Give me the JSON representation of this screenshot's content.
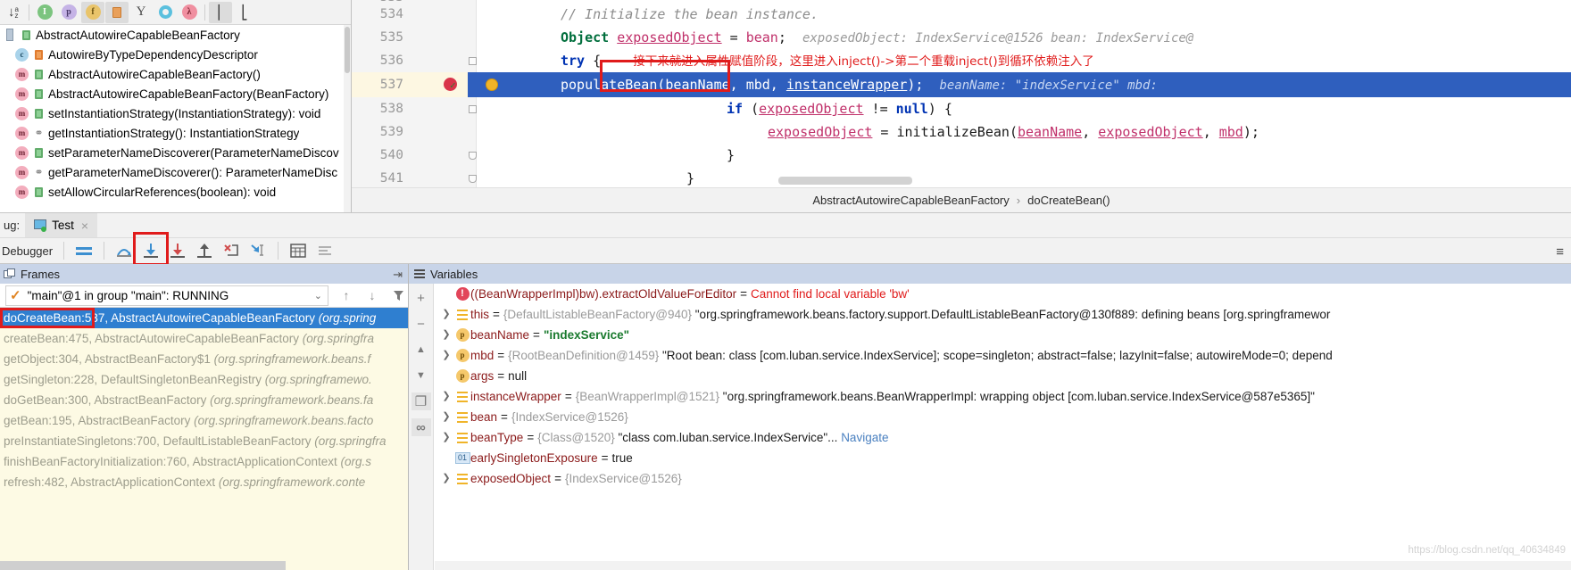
{
  "structure": {
    "toolbar_buttons": [
      {
        "name": "sort-alphabetically-icon",
        "glyph": "↓",
        "sub": "az",
        "selected": false
      },
      {
        "name": "show-inherited-icon",
        "glyph": "I",
        "color": "#7cc47f",
        "selected": false
      },
      {
        "name": "show-properties-icon",
        "glyph": "p",
        "color": "#c5b3e6",
        "selected": false
      },
      {
        "name": "show-fields-icon",
        "glyph": "f",
        "color": "#e9c46a",
        "selected": true
      },
      {
        "name": "show-non-public-icon",
        "glyph": "■",
        "color": "#e9a05a",
        "selected": true
      },
      {
        "name": "show-anonymous-classes-icon",
        "glyph": "Y",
        "color": "#5a5a5a",
        "selected": false
      },
      {
        "name": "show-lambdas-icon",
        "glyph": "○",
        "color": "#5bc0de",
        "selected": false
      },
      {
        "name": "show-lambda-bodies-icon",
        "glyph": "λ",
        "color": "#f08fa0",
        "selected": false
      },
      {
        "name": "expand-all-icon",
        "glyph": "⤒",
        "selected": true
      },
      {
        "name": "collapse-all-icon",
        "glyph": "⤓",
        "selected": false
      }
    ],
    "items": [
      {
        "kind": "class",
        "vis": "lock-green",
        "label": "AbstractAutowireCapableBeanFactory",
        "indent": 0
      },
      {
        "kind": "inner",
        "vis": "lock-orange",
        "label": "AutowireByTypeDependencyDescriptor",
        "indent": 1
      },
      {
        "kind": "method",
        "vis": "lock-green",
        "label": "AbstractAutowireCapableBeanFactory()",
        "indent": 1
      },
      {
        "kind": "method",
        "vis": "lock-green",
        "label": "AbstractAutowireCapableBeanFactory(BeanFactory)",
        "indent": 1
      },
      {
        "kind": "method",
        "vis": "lock-green",
        "label": "setInstantiationStrategy(InstantiationStrategy): void",
        "indent": 1
      },
      {
        "kind": "method",
        "vis": "key",
        "label": "getInstantiationStrategy(): InstantiationStrategy",
        "indent": 1
      },
      {
        "kind": "method",
        "vis": "lock-green",
        "label": "setParameterNameDiscoverer(ParameterNameDiscov",
        "indent": 1
      },
      {
        "kind": "method",
        "vis": "key",
        "label": "getParameterNameDiscoverer(): ParameterNameDisc",
        "indent": 1
      },
      {
        "kind": "method",
        "vis": "lock-green",
        "label": "setAllowCircularReferences(boolean): void",
        "indent": 1
      }
    ]
  },
  "editor": {
    "lines": [
      {
        "num": "533",
        "partial": true
      },
      {
        "num": "534"
      },
      {
        "num": "535"
      },
      {
        "num": "536"
      },
      {
        "num": "537",
        "current": true
      },
      {
        "num": "538"
      },
      {
        "num": "539"
      },
      {
        "num": "540"
      },
      {
        "num": "541"
      }
    ],
    "code": {
      "comment_534": "// Initialize the bean instance.",
      "l535_type": "Object",
      "l535_var": "exposedObject",
      "l535_eq": " = ",
      "l535_val": "bean",
      "l535_semi": ";",
      "l535_hint": "exposedObject:  IndexService@1526   bean:  IndexService@",
      "l536_try": "try",
      "l536_brace": " {",
      "l536_note": "接下来就进入属性赋值阶段，这里进入inject()->第二个重载inject()到循环依赖注入了",
      "l537_call": "populateBean",
      "l537_args": "(beanName, mbd, ",
      "l537_arg3": "instanceWrapper",
      "l537_tail": ");",
      "l537_hint": "beanName:  \"indexService\"   mbd:",
      "l538_if": "if",
      "l538_open": " (",
      "l538_var": "exposedObject",
      "l538_op": " != ",
      "l538_null": "null",
      "l538_close": ") {",
      "l539_var": "exposedObject",
      "l539_eq": " = ",
      "l539_call": "initializeBean",
      "l539_open": "(",
      "l539_a1": "beanName",
      "l539_c1": ", ",
      "l539_a2": "exposedObject",
      "l539_c2": ", ",
      "l539_a3": "mbd",
      "l539_close": ");",
      "l540_brace": "}",
      "l541_brace": "}"
    },
    "breadcrumb": {
      "class": "AbstractAutowireCapableBeanFactory",
      "separator": "›",
      "method": "doCreateBean()"
    }
  },
  "debug_window": {
    "label": "ug:",
    "tab_title": "Test",
    "tab_close": "×",
    "toolbar_title": "Debugger",
    "toolbar_buttons": [
      {
        "name": "show-execution-point-button",
        "glyph": "☰"
      },
      {
        "name": "step-over-button",
        "glyph": "⤴"
      },
      {
        "name": "step-into-button",
        "glyph": "↓",
        "highlighted": true
      },
      {
        "name": "force-step-into-button",
        "glyph": "↓"
      },
      {
        "name": "step-out-button",
        "glyph": "↑"
      },
      {
        "name": "drop-frame-button",
        "glyph": "✗"
      },
      {
        "name": "run-to-cursor-button",
        "glyph": "↘"
      },
      {
        "name": "evaluate-expression-button",
        "glyph": "▦"
      },
      {
        "name": "settings-button",
        "glyph": "≣"
      }
    ],
    "menu_glyph": "≡"
  },
  "frames": {
    "header": "Frames",
    "pin_glyph": "⇥",
    "thread": "\"main\"@1 in group \"main\": RUNNING",
    "chevron": "⌄",
    "nav_up": "↑",
    "nav_down": "↓",
    "filter": "ᐳ",
    "items": [
      {
        "method": "doCreateBean:537",
        "cls": ", AbstractAutowireCapableBeanFactory ",
        "pkg": "(org.spring",
        "active": true
      },
      {
        "method": "createBean:475",
        "cls": ", AbstractAutowireCapableBeanFactory ",
        "pkg": "(org.springfra",
        "active": false
      },
      {
        "method": "getObject:304",
        "cls": ", AbstractBeanFactory$1 ",
        "pkg": "(org.springframework.beans.f",
        "active": false
      },
      {
        "method": "getSingleton:228",
        "cls": ", DefaultSingletonBeanRegistry ",
        "pkg": "(org.springframewo.",
        "active": false
      },
      {
        "method": "doGetBean:300",
        "cls": ", AbstractBeanFactory ",
        "pkg": "(org.springframework.beans.fa",
        "active": false
      },
      {
        "method": "getBean:195",
        "cls": ", AbstractBeanFactory ",
        "pkg": "(org.springframework.beans.facto",
        "active": false
      },
      {
        "method": "preInstantiateSingletons:700",
        "cls": ", DefaultListableBeanFactory ",
        "pkg": "(org.springfra",
        "active": false
      },
      {
        "method": "finishBeanFactoryInitialization:760",
        "cls": ", AbstractApplicationContext ",
        "pkg": "(org.s",
        "active": false
      },
      {
        "method": "refresh:482",
        "cls": ", AbstractApplicationContext ",
        "pkg": "(org.springframework.conte",
        "active": false
      }
    ]
  },
  "variables": {
    "header": "Variables",
    "side_buttons": [
      {
        "name": "add-watch-button",
        "glyph": "+"
      },
      {
        "name": "remove-watch-button",
        "glyph": "−"
      },
      {
        "name": "move-watch-up-button",
        "glyph": "▲"
      },
      {
        "name": "move-watch-down-button",
        "glyph": "▼"
      },
      {
        "name": "copy-value-button",
        "glyph": "❐"
      },
      {
        "name": "inline-watches-button",
        "glyph": "∞"
      }
    ],
    "rows": [
      {
        "icon": "error-icon",
        "expandable": false,
        "name": "((BeanWrapperImpl)bw).extractOldValueForEditor",
        "eq": " = ",
        "value": "Cannot find local variable 'bw'",
        "value_kind": "error"
      },
      {
        "icon": "object-icon",
        "expandable": true,
        "name": "this",
        "eq": " = ",
        "ref": "{DefaultListableBeanFactory@940}",
        "value": "\"org.springframework.beans.factory.support.DefaultListableBeanFactory@130f889: defining beans [org.springframewor",
        "value_kind": "string"
      },
      {
        "icon": "param-icon",
        "expandable": true,
        "name": "beanName",
        "eq": " = ",
        "value": "\"indexService\"",
        "value_kind": "string-green"
      },
      {
        "icon": "param-icon",
        "expandable": true,
        "name": "mbd",
        "eq": " = ",
        "ref": "{RootBeanDefinition@1459}",
        "value": "\"Root bean: class [com.luban.service.IndexService]; scope=singleton; abstract=false; lazyInit=false; autowireMode=0; depend",
        "value_kind": "string"
      },
      {
        "icon": "param-icon",
        "expandable": false,
        "name": "args",
        "eq": " = ",
        "value": "null",
        "value_kind": "null"
      },
      {
        "icon": "object-icon",
        "expandable": true,
        "name": "instanceWrapper",
        "eq": " = ",
        "ref": "{BeanWrapperImpl@1521}",
        "value": "\"org.springframework.beans.BeanWrapperImpl: wrapping object [com.luban.service.IndexService@587e5365]\"",
        "value_kind": "string"
      },
      {
        "icon": "object-icon",
        "expandable": true,
        "name": "bean",
        "eq": " = ",
        "ref": "{IndexService@1526}",
        "value": "",
        "value_kind": "string"
      },
      {
        "icon": "object-icon",
        "expandable": true,
        "name": "beanType",
        "eq": " = ",
        "ref": "{Class@1520}",
        "value": "\"class com.luban.service.IndexService\"...",
        "value_kind": "string",
        "link": "Navigate"
      },
      {
        "icon": "bool-icon",
        "expandable": false,
        "name": "earlySingletonExposure",
        "eq": " = ",
        "value": "true",
        "value_kind": "bool"
      },
      {
        "icon": "object-icon",
        "expandable": true,
        "name": "exposedObject",
        "eq": " = ",
        "ref": "{IndexService@1526}",
        "value": "",
        "value_kind": "string"
      }
    ]
  },
  "watermark": "https://blog.csdn.net/qq_40634849",
  "colors": {
    "selection_blue": "#2f5fbe",
    "frame_active_blue": "#2f7fd0",
    "annotation_red": "#e01b1b",
    "panel_header_blue": "#c8d4e8",
    "frames_bg": "#fdfae4",
    "current_line": "#fdf7e2"
  }
}
